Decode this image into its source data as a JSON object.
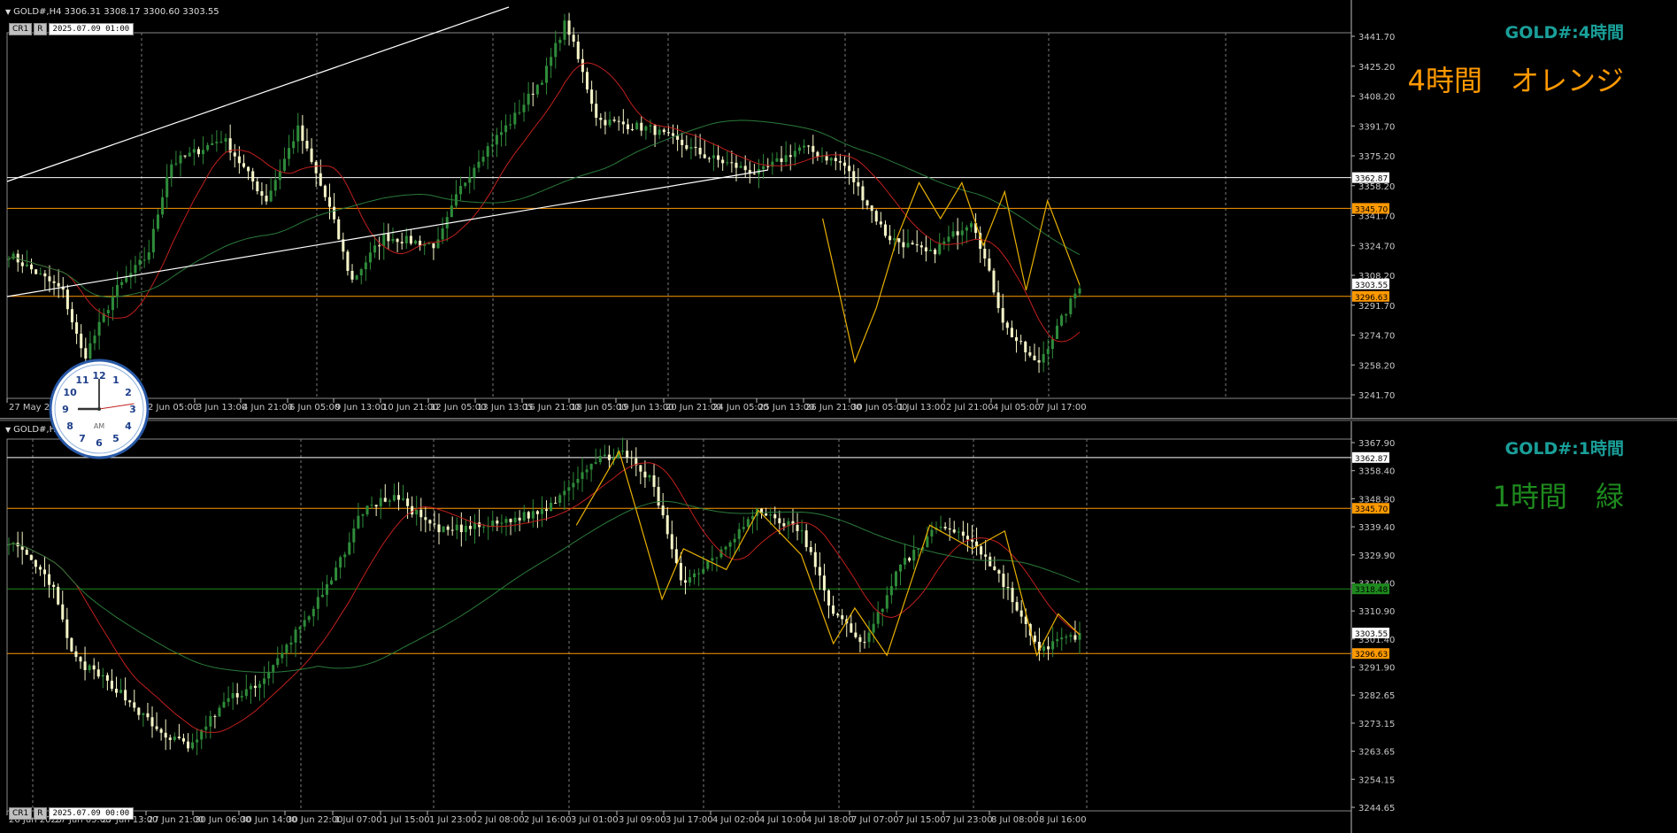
{
  "pane1": {
    "header": "GOLD#,H4  3306.31 3308.17 3300.60 3303.55",
    "btn1": "CR1",
    "btn2": "R",
    "datetime": "2025.07.09 01:00",
    "symbol_label": "GOLD#:4時間",
    "note": "4時間　オレンジ",
    "note_color": "#ff9900",
    "price_labels": [
      "3441.70",
      "3425.20",
      "3408.20",
      "3391.70",
      "3375.20",
      "3358.20",
      "3341.70",
      "3324.70",
      "3308.20",
      "3291.70",
      "3274.70",
      "3258.20",
      "3241.70"
    ],
    "tag_levels": [
      {
        "value": "3362.87",
        "color": "#ffffff",
        "text_color": "#000000"
      },
      {
        "value": "3345.70",
        "color": "#ff9900",
        "text_color": "#000000"
      },
      {
        "value": "3303.55",
        "color": "#ffffff",
        "text_color": "#000000"
      },
      {
        "value": "3296.63",
        "color": "#ff9900",
        "text_color": "#000000"
      }
    ],
    "time_labels": [
      "27 May 2025",
      "2 Jun 05:00",
      "3 Jun 13:00",
      "4 Jun 21:00",
      "6 Jun 05:00",
      "9 Jun 13:00",
      "10 Jun 21:00",
      "12 Jun 05:00",
      "13 Jun 13:05",
      "16 Jun 21:00",
      "18 Jun 05:00",
      "19 Jun 13:00",
      "20 Jun 21:00",
      "24 Jun 05:00",
      "25 Jun 13:00",
      "26 Jun 21:00",
      "30 Jun 05:00",
      "1 Jul 13:00",
      "2 Jul 21:00",
      "4 Jul 05:00",
      "7 Jul 17:00"
    ]
  },
  "pane2": {
    "header": "GOLD#,H1  3300.40 3303.55",
    "btn1": "CR1",
    "btn2": "R",
    "datetime": "2025.07.09 00:00",
    "symbol_label": "GOLD#:1時間",
    "note": "1時間　緑",
    "note_color": "#1e8a1e",
    "price_labels": [
      "3367.90",
      "3358.40",
      "3348.90",
      "3339.40",
      "3329.90",
      "3320.40",
      "3310.90",
      "3301.40",
      "3291.90",
      "3282.65",
      "3273.15",
      "3263.65",
      "3254.15",
      "3244.65"
    ],
    "tag_levels": [
      {
        "value": "3362.87",
        "color": "#ffffff",
        "text_color": "#000000"
      },
      {
        "value": "3345.70",
        "color": "#ff9900",
        "text_color": "#000000"
      },
      {
        "value": "3318.48",
        "color": "#1e8a1e",
        "text_color": "#000000"
      },
      {
        "value": "3303.55",
        "color": "#ffffff",
        "text_color": "#000000"
      },
      {
        "value": "3296.63",
        "color": "#ff9900",
        "text_color": "#000000"
      }
    ],
    "time_labels": [
      "26 Jun 2025",
      "27 Jun 05:00",
      "27 Jun 13:00",
      "27 Jun 21:00",
      "30 Jun 06:00",
      "30 Jun 14:00",
      "30 Jun 22:00",
      "1 Jul 07:00",
      "1 Jul 15:00",
      "1 Jul 23:00",
      "2 Jul 08:00",
      "2 Jul 16:00",
      "3 Jul 01:00",
      "3 Jul 09:00",
      "3 Jul 17:00",
      "4 Jul 02:00",
      "4 Jul 10:00",
      "4 Jul 18:00",
      "7 Jul 07:00",
      "7 Jul 15:00",
      "7 Jul 23:00",
      "8 Jul 08:00",
      "8 Jul 16:00"
    ]
  },
  "clock": {
    "numbers": [
      "12",
      "1",
      "2",
      "3",
      "4",
      "5",
      "6",
      "7",
      "8",
      "9",
      "10",
      "11"
    ],
    "ampm": "AM",
    "hour": 9,
    "minute": 0
  },
  "colors": {
    "bull": "#2e8b3a",
    "bear": "#f5f5c8",
    "ma_fast": "#c0201d",
    "ma_slow": "#2a7a3a",
    "zigzag": "#e8b000",
    "grid": "#7a7a7a",
    "axis_text": "#c8c8c8"
  }
}
